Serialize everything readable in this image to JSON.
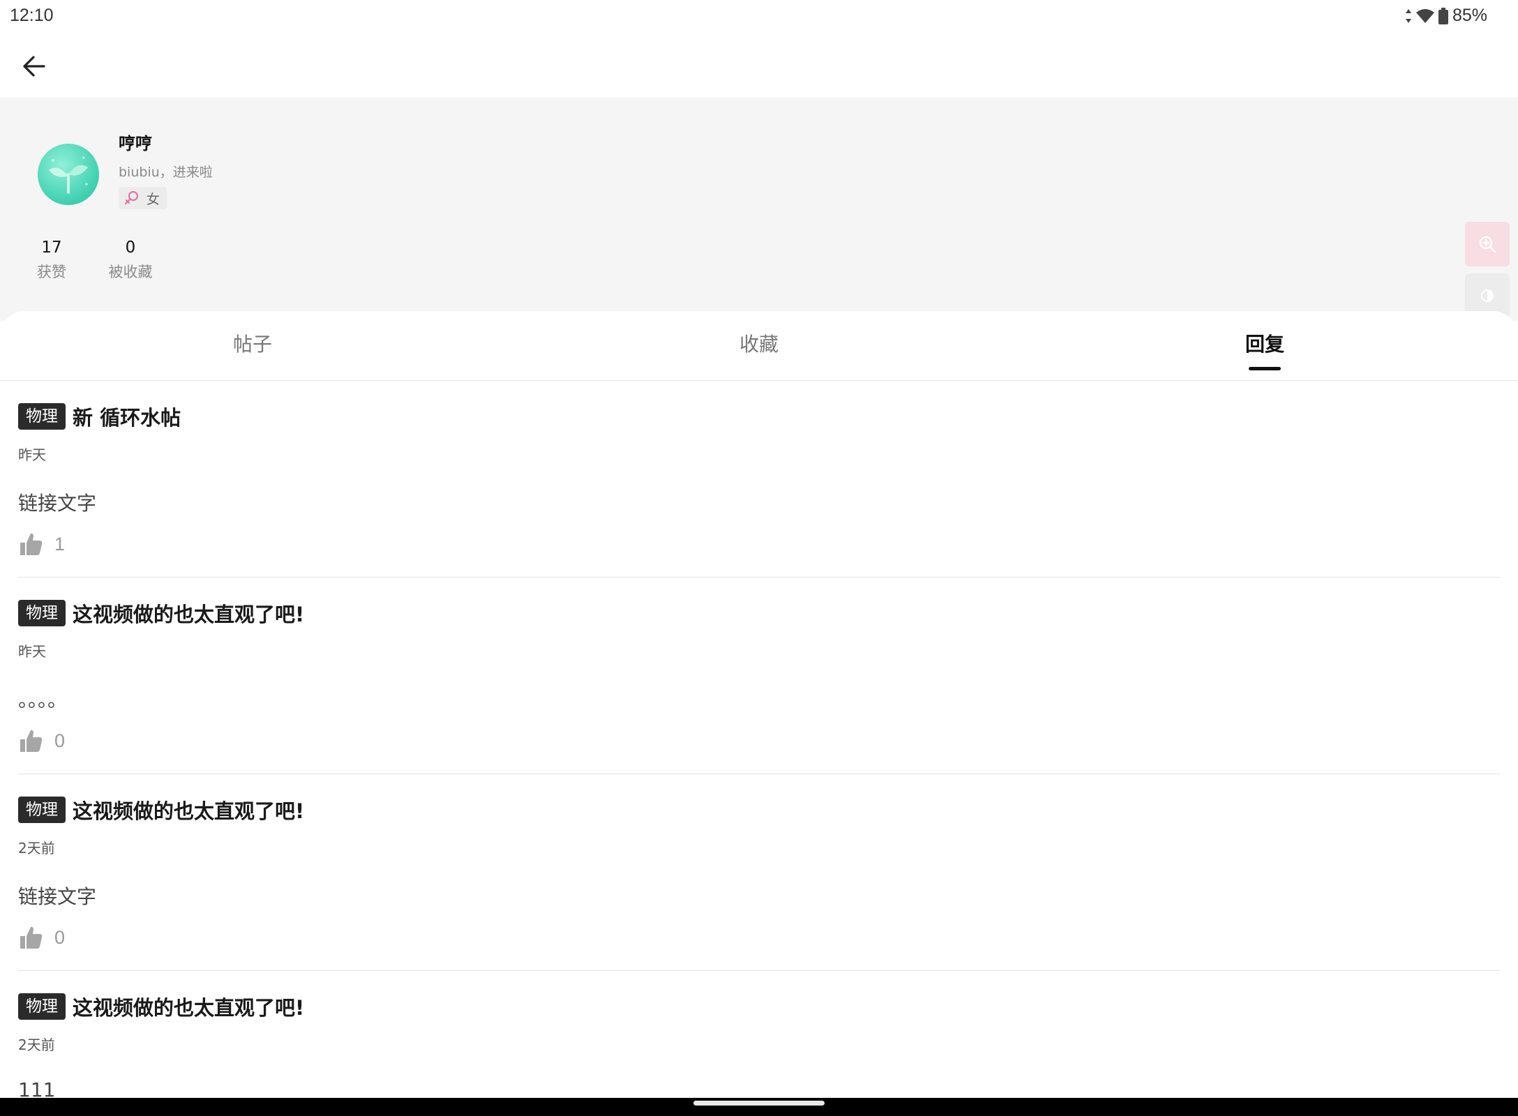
{
  "status_bar": {
    "time": "12:10",
    "battery": "85%"
  },
  "profile": {
    "username": "哼哼",
    "bio": "biubiu，进来啦",
    "gender": "女",
    "stats": [
      {
        "value": "17",
        "label": "获赞"
      },
      {
        "value": "0",
        "label": "被收藏"
      }
    ]
  },
  "tabs": [
    {
      "label": "帖子"
    },
    {
      "label": "收藏"
    },
    {
      "label": "回复"
    }
  ],
  "active_tab": "回复",
  "replies": [
    {
      "tag": "物理",
      "title": "新 循环水帖",
      "time": "昨天",
      "content": "链接文字",
      "likes": "1"
    },
    {
      "tag": "物理",
      "title": "这视频做的也太直观了吧!",
      "time": "昨天",
      "content": "。。。。",
      "likes": "0"
    },
    {
      "tag": "物理",
      "title": "这视频做的也太直观了吧!",
      "time": "2天前",
      "content": "链接文字",
      "likes": "0"
    },
    {
      "tag": "物理",
      "title": "这视频做的也太直观了吧!",
      "time": "2天前",
      "content": "111",
      "likes": ""
    }
  ],
  "icons": {
    "back": "arrow-left-icon",
    "gender": "female-icon",
    "like": "thumbs-up-icon",
    "float": [
      "zoom-in-icon",
      "contrast-icon",
      "brightness-icon"
    ]
  },
  "colors": {
    "tag_bg": "#2b2b2b",
    "header_bg": "#f4f5f4",
    "gender_accent": "#e86aa0",
    "avatar": "#3fd0b0"
  }
}
